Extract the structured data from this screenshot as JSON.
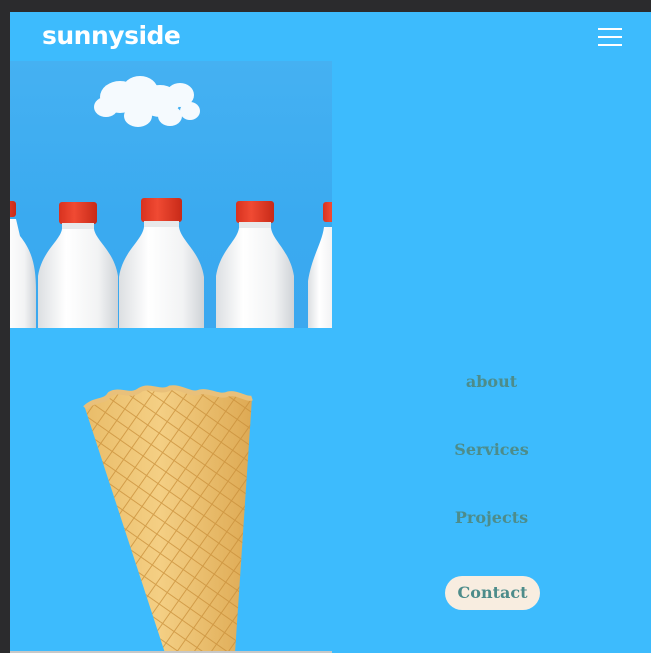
{
  "header": {
    "logo": "sunnyside",
    "menu_icon": "hamburger-menu-icon"
  },
  "gallery": {
    "items": [
      {
        "subject": "milk-bottles-image"
      },
      {
        "subject": "ice-cream-cone-image"
      }
    ]
  },
  "menu": {
    "items": [
      {
        "label": "about"
      },
      {
        "label": "Services"
      },
      {
        "label": "Projects"
      }
    ],
    "contact_label": "Contact"
  },
  "colors": {
    "background": "#3dbbfd",
    "menu_text": "#4d8c8a",
    "contact_button": "#f8ede0",
    "logo": "#ffffff"
  }
}
